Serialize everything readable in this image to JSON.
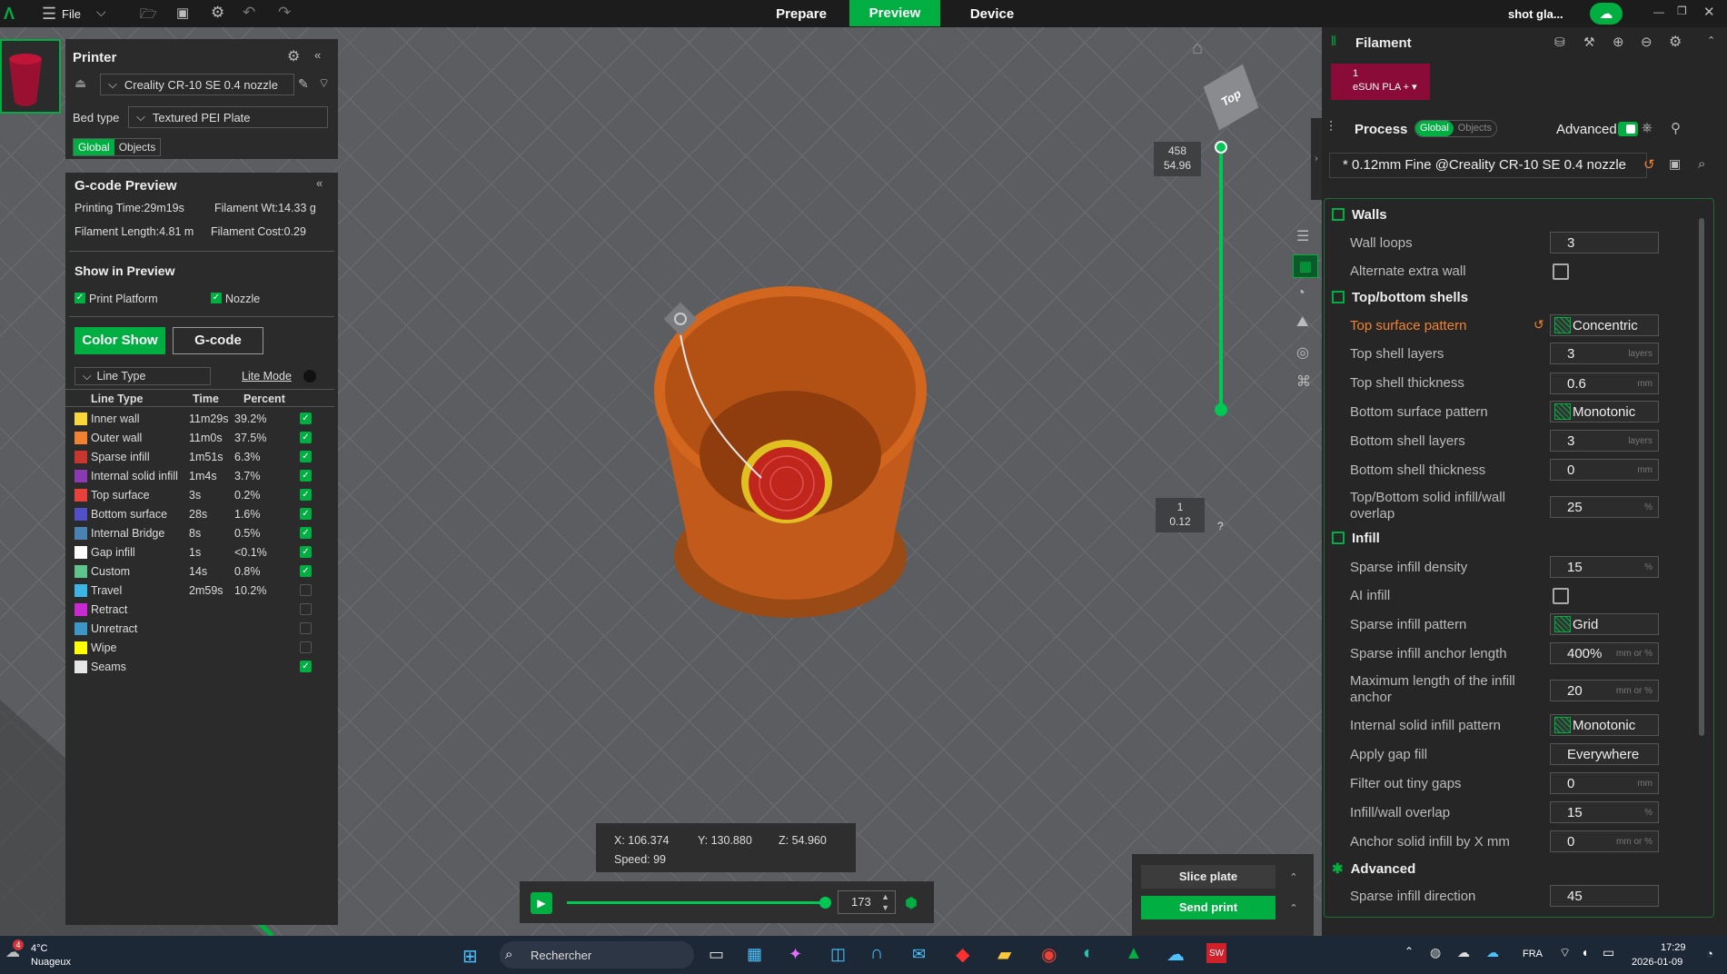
{
  "topbar": {
    "file": "File",
    "tabs": [
      "Prepare",
      "Preview",
      "Device"
    ],
    "active_tab": "Preview",
    "project": "shot gla..."
  },
  "printer": {
    "title": "Printer",
    "printer_name": "Creality CR-10 SE 0.4 nozzle",
    "bed_type_label": "Bed type",
    "bed_type": "Textured PEI Plate",
    "global": "Global",
    "objects": "Objects"
  },
  "gcode": {
    "title": "G-code Preview",
    "printing_time": "Printing Time:29m19s",
    "filament_wt": "Filament Wt:14.33 g",
    "filament_length": "Filament Length:4.81 m",
    "filament_cost": "Filament Cost:0.29",
    "show_title": "Show in Preview",
    "print_platform": "Print Platform",
    "nozzle": "Nozzle",
    "color_show": "Color Show",
    "gcode_btn": "G-code",
    "line_type_combo": "Line Type",
    "lite_mode": "Lite Mode",
    "headers": [
      "Line Type",
      "Time",
      "Percent"
    ],
    "rows": [
      {
        "name": "Inner wall",
        "time": "11m29s",
        "pct": "39.2%",
        "color": "#f8d63c",
        "checked": true
      },
      {
        "name": "Outer wall",
        "time": "11m0s",
        "pct": "37.5%",
        "color": "#f28232",
        "checked": true
      },
      {
        "name": "Sparse infill",
        "time": "1m51s",
        "pct": "6.3%",
        "color": "#c8372d",
        "checked": true
      },
      {
        "name": "Internal solid infill",
        "time": "1m4s",
        "pct": "3.7%",
        "color": "#8c3ab4",
        "checked": true
      },
      {
        "name": "Top surface",
        "time": "3s",
        "pct": "0.2%",
        "color": "#e8413c",
        "checked": true
      },
      {
        "name": "Bottom surface",
        "time": "28s",
        "pct": "1.6%",
        "color": "#5050c8",
        "checked": true
      },
      {
        "name": "Internal Bridge",
        "time": "8s",
        "pct": "0.5%",
        "color": "#4b82b4",
        "checked": true
      },
      {
        "name": "Gap infill",
        "time": "1s",
        "pct": "<0.1%",
        "color": "#ffffff",
        "checked": true
      },
      {
        "name": "Custom",
        "time": "14s",
        "pct": "0.8%",
        "color": "#5ec48c",
        "checked": true
      },
      {
        "name": "Travel",
        "time": "2m59s",
        "pct": "10.2%",
        "color": "#3cb4e6",
        "checked": false
      },
      {
        "name": "Retract",
        "time": "",
        "pct": "",
        "color": "#c82ad2",
        "checked": false
      },
      {
        "name": "Unretract",
        "time": "",
        "pct": "",
        "color": "#3c96c8",
        "checked": false
      },
      {
        "name": "Wipe",
        "time": "",
        "pct": "",
        "color": "#ffff00",
        "checked": false
      },
      {
        "name": "Seams",
        "time": "",
        "pct": "",
        "color": "#e6e6e6",
        "checked": true
      }
    ]
  },
  "view": {
    "top_label": "Top",
    "layer_top": "458",
    "height_top": "54.96",
    "layer_bottom": "1",
    "height_bottom": "0.12",
    "help": "?",
    "x": "X: 106.374",
    "y": "Y: 130.880",
    "z": "Z: 54.960",
    "speed": "Speed: 99",
    "move": "173",
    "slice": "Slice plate",
    "send": "Send print",
    "layer_progress": 1.0,
    "move_progress": 1.0
  },
  "filament": {
    "title": "Filament",
    "slot": "1",
    "name": "eSUN PLA +"
  },
  "process": {
    "title": "Process",
    "global": "Global",
    "objects": "Objects",
    "advanced": "Advanced",
    "preset": "* 0.12mm Fine @Creality CR-10 SE 0.4 nozzle",
    "walls": "Walls",
    "wall_loops": "Wall loops",
    "wall_loops_v": "3",
    "alt_wall": "Alternate extra wall",
    "topbottom": "Top/bottom shells",
    "top_pattern": "Top surface pattern",
    "top_pattern_v": "Concentric",
    "top_layers": "Top shell layers",
    "top_layers_v": "3",
    "layers_u": "layers",
    "top_thick": "Top shell thickness",
    "top_thick_v": "0.6",
    "mm": "mm",
    "bot_pattern": "Bottom surface pattern",
    "bot_pattern_v": "Monotonic",
    "bot_layers": "Bottom shell layers",
    "bot_layers_v": "3",
    "bot_thick": "Bottom shell thickness",
    "bot_thick_v": "0",
    "overlap": "Top/Bottom solid infill/wall overlap",
    "overlap_v": "25",
    "pct": "%",
    "infill": "Infill",
    "density": "Sparse infill density",
    "density_v": "15",
    "ai": "AI infill",
    "inf_pattern": "Sparse infill pattern",
    "inf_pattern_v": "Grid",
    "anchor": "Sparse infill anchor length",
    "anchor_v": "400%",
    "mmpct": "mm or %",
    "anchor_max": "Maximum length of the infill anchor",
    "anchor_max_v": "20",
    "isolid": "Internal solid infill pattern",
    "isolid_v": "Monotonic",
    "gap": "Apply gap fill",
    "gap_v": "Everywhere",
    "tiny": "Filter out tiny gaps",
    "tiny_v": "0",
    "iwo": "Infill/wall overlap",
    "iwo_v": "15",
    "anchor_solid": "Anchor solid infill by X mm",
    "anchor_solid_v": "0",
    "advanced_sec": "Advanced",
    "direction": "Sparse infill direction",
    "direction_v": "45"
  },
  "taskbar": {
    "weather_temp": "4°C",
    "weather_desc": "Nuageux",
    "weather_badge": "4",
    "search": "Rechercher",
    "lang": "FRA",
    "time": "17:29",
    "date": "2026-01-09"
  }
}
